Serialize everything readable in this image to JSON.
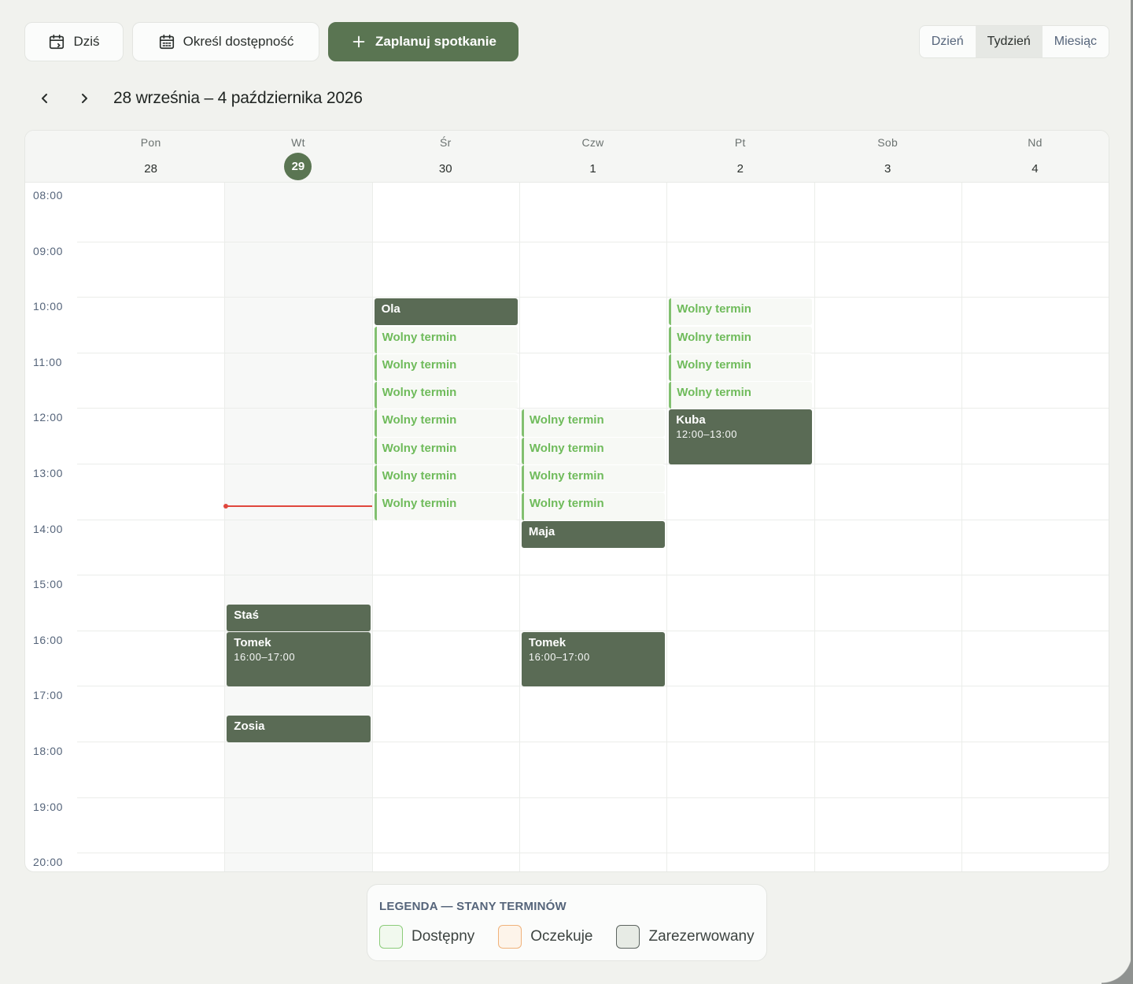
{
  "toolbar": {
    "today_label": "Dziś",
    "availability_label": "Określ dostępność",
    "schedule_label": "Zaplanuj spotkanie",
    "views": [
      "Dzień",
      "Tydzień",
      "Miesiąc"
    ],
    "active_view": "Tydzień"
  },
  "range": {
    "title": "28 września – 4 października 2026"
  },
  "days": [
    {
      "name": "Pon",
      "num": "28"
    },
    {
      "name": "Wt",
      "num": "29",
      "today": true
    },
    {
      "name": "Śr",
      "num": "30"
    },
    {
      "name": "Czw",
      "num": "1"
    },
    {
      "name": "Pt",
      "num": "2"
    },
    {
      "name": "Sob",
      "num": "3"
    },
    {
      "name": "Nd",
      "num": "4"
    }
  ],
  "hours": [
    "08:00",
    "09:00",
    "10:00",
    "11:00",
    "12:00",
    "13:00",
    "14:00",
    "15:00",
    "16:00",
    "17:00",
    "18:00",
    "19:00",
    "20:00"
  ],
  "now": {
    "day": 1,
    "time": 13.75
  },
  "events": [
    {
      "day": 2,
      "start": 10.0,
      "end": 10.5,
      "type": "booked",
      "title": "Ola"
    },
    {
      "day": 2,
      "start": 10.5,
      "end": 11.0,
      "type": "free",
      "title": "Wolny termin"
    },
    {
      "day": 2,
      "start": 11.0,
      "end": 11.5,
      "type": "free",
      "title": "Wolny termin"
    },
    {
      "day": 2,
      "start": 11.5,
      "end": 12.0,
      "type": "free",
      "title": "Wolny termin"
    },
    {
      "day": 2,
      "start": 12.0,
      "end": 12.5,
      "type": "free",
      "title": "Wolny termin"
    },
    {
      "day": 2,
      "start": 12.5,
      "end": 13.0,
      "type": "free",
      "title": "Wolny termin"
    },
    {
      "day": 2,
      "start": 13.0,
      "end": 13.5,
      "type": "free",
      "title": "Wolny termin"
    },
    {
      "day": 2,
      "start": 13.5,
      "end": 14.0,
      "type": "free",
      "title": "Wolny termin"
    },
    {
      "day": 3,
      "start": 12.0,
      "end": 12.5,
      "type": "free",
      "title": "Wolny termin"
    },
    {
      "day": 3,
      "start": 12.5,
      "end": 13.0,
      "type": "free",
      "title": "Wolny termin"
    },
    {
      "day": 3,
      "start": 13.0,
      "end": 13.5,
      "type": "free",
      "title": "Wolny termin"
    },
    {
      "day": 3,
      "start": 13.5,
      "end": 14.0,
      "type": "free",
      "title": "Wolny termin"
    },
    {
      "day": 3,
      "start": 14.0,
      "end": 14.5,
      "type": "booked",
      "title": "Maja"
    },
    {
      "day": 3,
      "start": 16.0,
      "end": 17.0,
      "type": "booked",
      "title": "Tomek",
      "subtitle": "16:00–17:00"
    },
    {
      "day": 4,
      "start": 10.0,
      "end": 10.5,
      "type": "free",
      "title": "Wolny termin"
    },
    {
      "day": 4,
      "start": 10.5,
      "end": 11.0,
      "type": "free",
      "title": "Wolny termin"
    },
    {
      "day": 4,
      "start": 11.0,
      "end": 11.5,
      "type": "free",
      "title": "Wolny termin"
    },
    {
      "day": 4,
      "start": 11.5,
      "end": 12.0,
      "type": "free",
      "title": "Wolny termin"
    },
    {
      "day": 4,
      "start": 12.0,
      "end": 13.0,
      "type": "booked",
      "title": "Kuba",
      "subtitle": "12:00–13:00"
    },
    {
      "day": 1,
      "start": 15.5,
      "end": 16.0,
      "type": "booked",
      "title": "Staś"
    },
    {
      "day": 1,
      "start": 16.0,
      "end": 17.0,
      "type": "booked",
      "title": "Tomek",
      "subtitle": "16:00–17:00"
    },
    {
      "day": 1,
      "start": 17.5,
      "end": 18.0,
      "type": "booked",
      "title": "Zosia"
    }
  ],
  "legend": {
    "title": "LEGENDA — STANY TERMINÓW",
    "items": [
      {
        "label": "Dostępny",
        "fill": "#f1f9ee",
        "border": "#8ccc7a"
      },
      {
        "label": "Oczekuje",
        "fill": "#fdf4ea",
        "border": "#f0b27a"
      },
      {
        "label": "Zarezerwowany",
        "fill": "#e7ebe5",
        "border": "#5c6460"
      }
    ]
  },
  "colors": {
    "accent": "#5a7552",
    "booked": "#5a6b55",
    "free_text": "#6fbb5b",
    "now_line": "#e0473d"
  }
}
